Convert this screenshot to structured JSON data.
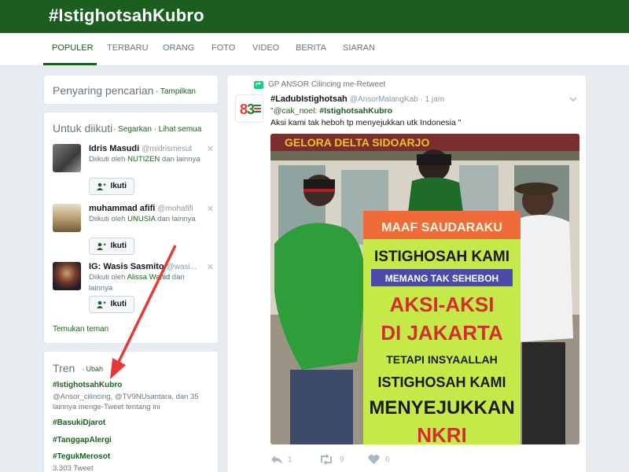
{
  "header": {
    "title": "#IstighotsahKubro"
  },
  "nav": {
    "tabs": [
      {
        "label": "POPULER"
      },
      {
        "label": "TERBARU"
      },
      {
        "label": "ORANG"
      },
      {
        "label": "FOTO"
      },
      {
        "label": "VIDEO"
      },
      {
        "label": "BERITA"
      },
      {
        "label": "SIARAN"
      }
    ],
    "active_tab": "POPULER"
  },
  "filter": {
    "title": "Penyaring pencarian",
    "action": "· Tampilkan"
  },
  "who_to_follow": {
    "title": "Untuk diikuti",
    "actions": "· Segarkan · Lihat semua",
    "users": [
      {
        "name": "Idris Masudi",
        "handle": "@midrismesut",
        "context_prefix": "Diikuti oleh",
        "context_name": "NUTIZEN",
        "context_suffix": "dan lainnya",
        "follow_label": "Ikuti"
      },
      {
        "name": "muhammad afifi",
        "handle": "@mohafifi",
        "context_prefix": "Diikuti oleh",
        "context_name": "UNUSIA",
        "context_suffix": "dan lainnya",
        "follow_label": "Ikuti"
      },
      {
        "name": "IG: Wasis Sasmito",
        "handle": "@wasi...",
        "context_prefix": "Diikuti oleh",
        "context_name": "Alissa Wahid",
        "context_suffix": "dan lainnya",
        "follow_label": "Ikuti"
      }
    ],
    "find_friends": "Temukan teman"
  },
  "trends": {
    "title": "Tren",
    "action": "· Ubah",
    "items": [
      {
        "tag": "#IstighotsahKubro",
        "desc": "@Ansor_cilincing, @TV9NUsantara, dan 35 lainnya menge-Tweet tentang ini"
      },
      {
        "tag": "#BasukiDjarot",
        "desc": ""
      },
      {
        "tag": "#TanggapAlergi",
        "desc": ""
      },
      {
        "tag": "#TegukMerosot",
        "desc": "3.303 Tweet"
      }
    ]
  },
  "tweet": {
    "retweet_line": "GP ANSOR Cilincing me-Retweet",
    "author_name": "#LadubIstighotsah",
    "author_handle": "@AnsorMalangKab · 1 jam",
    "reply_prefix": "\"@cak_noel:",
    "reply_tag": "#IstighotsahKubro",
    "text": "Aksi kami tak heboh tp menyejukkan utk Indonesia \"",
    "photo_signs": {
      "building": "GELORA DELTA SIDOARJO",
      "line1": "MAAF SAUDARAKU",
      "line2": "ISTIGHOSAH KAMI",
      "line3": "MEMANG TAK SEHEBOH",
      "line4": "AKSI-AKSI",
      "line5": "DI JAKARTA",
      "line6": "TETAPI INSYAALLAH",
      "line7": "ISTIGHOSAH KAMI",
      "line8": "MENYEJUKKAN",
      "line9": "NKRI"
    },
    "stats": {
      "replies": "1",
      "retweets": "9",
      "likes": "6"
    }
  },
  "colors": {
    "brand": "#1b5e20",
    "arrow": "#e53935",
    "banner": "#c6e94a"
  },
  "icons": [
    "user-plus-icon",
    "close-icon",
    "chevron-down-icon",
    "reply-icon",
    "retweet-icon",
    "heart-icon"
  ]
}
